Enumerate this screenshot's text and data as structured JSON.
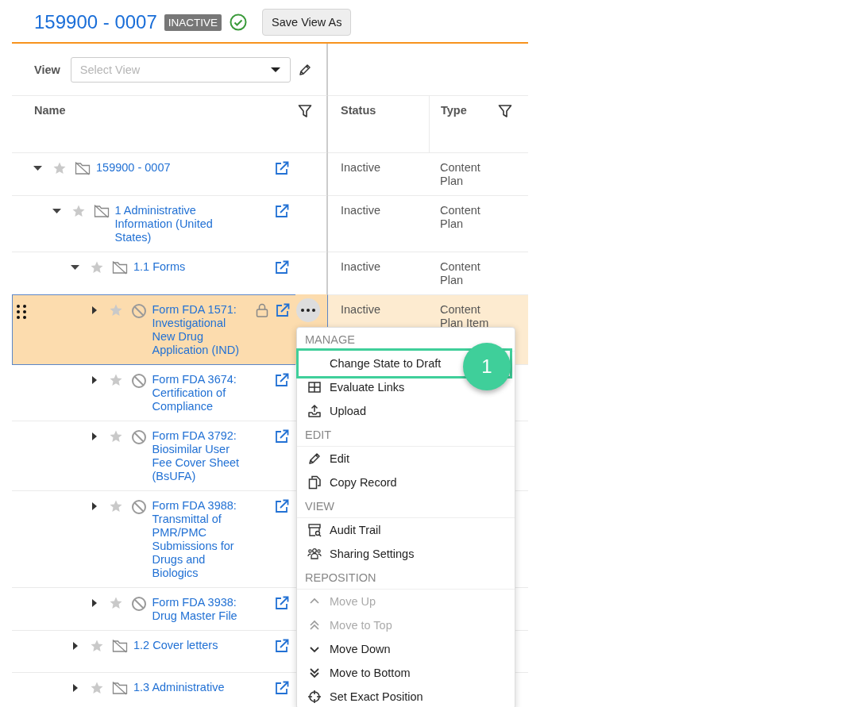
{
  "header": {
    "title": "159900 - 0007",
    "status_badge": "INACTIVE",
    "save_button": "Save View As"
  },
  "view_picker": {
    "label": "View",
    "placeholder": "Select View"
  },
  "columns": [
    {
      "label": "Name",
      "filter": true
    },
    {
      "label": "Status",
      "filter": false
    },
    {
      "label": "Type",
      "filter": true
    }
  ],
  "tree": [
    {
      "name": "159900 - 0007",
      "kind": "section",
      "expanded": true,
      "selected": false,
      "locked": false,
      "status": "Inactive",
      "type": "Content Plan",
      "children": [
        {
          "name": "1 Administrative Information (United States)",
          "kind": "section",
          "expanded": true,
          "selected": false,
          "locked": false,
          "status": "Inactive",
          "type": "Content Plan",
          "children": [
            {
              "name": "1.1 Forms",
              "kind": "section",
              "expanded": true,
              "selected": false,
              "locked": false,
              "status": "Inactive",
              "type": "Content Plan",
              "children": [
                {
                  "name": "Form FDA 1571: Investigational New Drug Application (IND)",
                  "kind": "item",
                  "expanded": false,
                  "selected": true,
                  "locked": true,
                  "status": "Inactive",
                  "type": "Content Plan Item"
                },
                {
                  "name": "Form FDA 3674: Certification of Compliance",
                  "kind": "item",
                  "expanded": false,
                  "selected": false,
                  "locked": false
                },
                {
                  "name": "Form FDA 3792: Biosimilar User Fee Cover Sheet (BsUFA)",
                  "kind": "item",
                  "expanded": false,
                  "selected": false,
                  "locked": false
                },
                {
                  "name": "Form FDA 3988: Transmittal of PMR/PMC Submissions for Drugs and Biologics",
                  "kind": "item",
                  "expanded": false,
                  "selected": false,
                  "locked": false
                },
                {
                  "name": "Form FDA 3938: Drug Master File",
                  "kind": "item",
                  "expanded": false,
                  "selected": false,
                  "locked": false
                }
              ]
            },
            {
              "name": "1.2 Cover letters",
              "kind": "section",
              "expanded": false,
              "selected": false,
              "locked": false
            },
            {
              "name": "1.3 Administrative",
              "kind": "section",
              "expanded": false,
              "selected": false,
              "locked": false
            }
          ]
        }
      ]
    }
  ],
  "context_menu": {
    "sections": [
      {
        "title": "MANAGE",
        "items": [
          {
            "label": "Change State to Draft",
            "disabled": false,
            "highlighted": true
          },
          {
            "label": "Evaluate Links",
            "disabled": false,
            "highlighted": false
          },
          {
            "label": "Upload",
            "disabled": false,
            "highlighted": false
          }
        ]
      },
      {
        "title": "EDIT",
        "items": [
          {
            "label": "Edit",
            "disabled": false,
            "highlighted": false
          },
          {
            "label": "Copy Record",
            "disabled": false,
            "highlighted": false
          }
        ]
      },
      {
        "title": "VIEW",
        "items": [
          {
            "label": "Audit Trail",
            "disabled": false,
            "highlighted": false
          },
          {
            "label": "Sharing Settings",
            "disabled": false,
            "highlighted": false
          }
        ]
      },
      {
        "title": "REPOSITION",
        "items": [
          {
            "label": "Move Up",
            "disabled": true,
            "highlighted": false
          },
          {
            "label": "Move to Top",
            "disabled": true,
            "highlighted": false
          },
          {
            "label": "Move Down",
            "disabled": false,
            "highlighted": false
          },
          {
            "label": "Move to Bottom",
            "disabled": false,
            "highlighted": false
          },
          {
            "label": "Set Exact Position",
            "disabled": false,
            "highlighted": false
          }
        ]
      }
    ]
  },
  "callout": {
    "label": "1"
  }
}
